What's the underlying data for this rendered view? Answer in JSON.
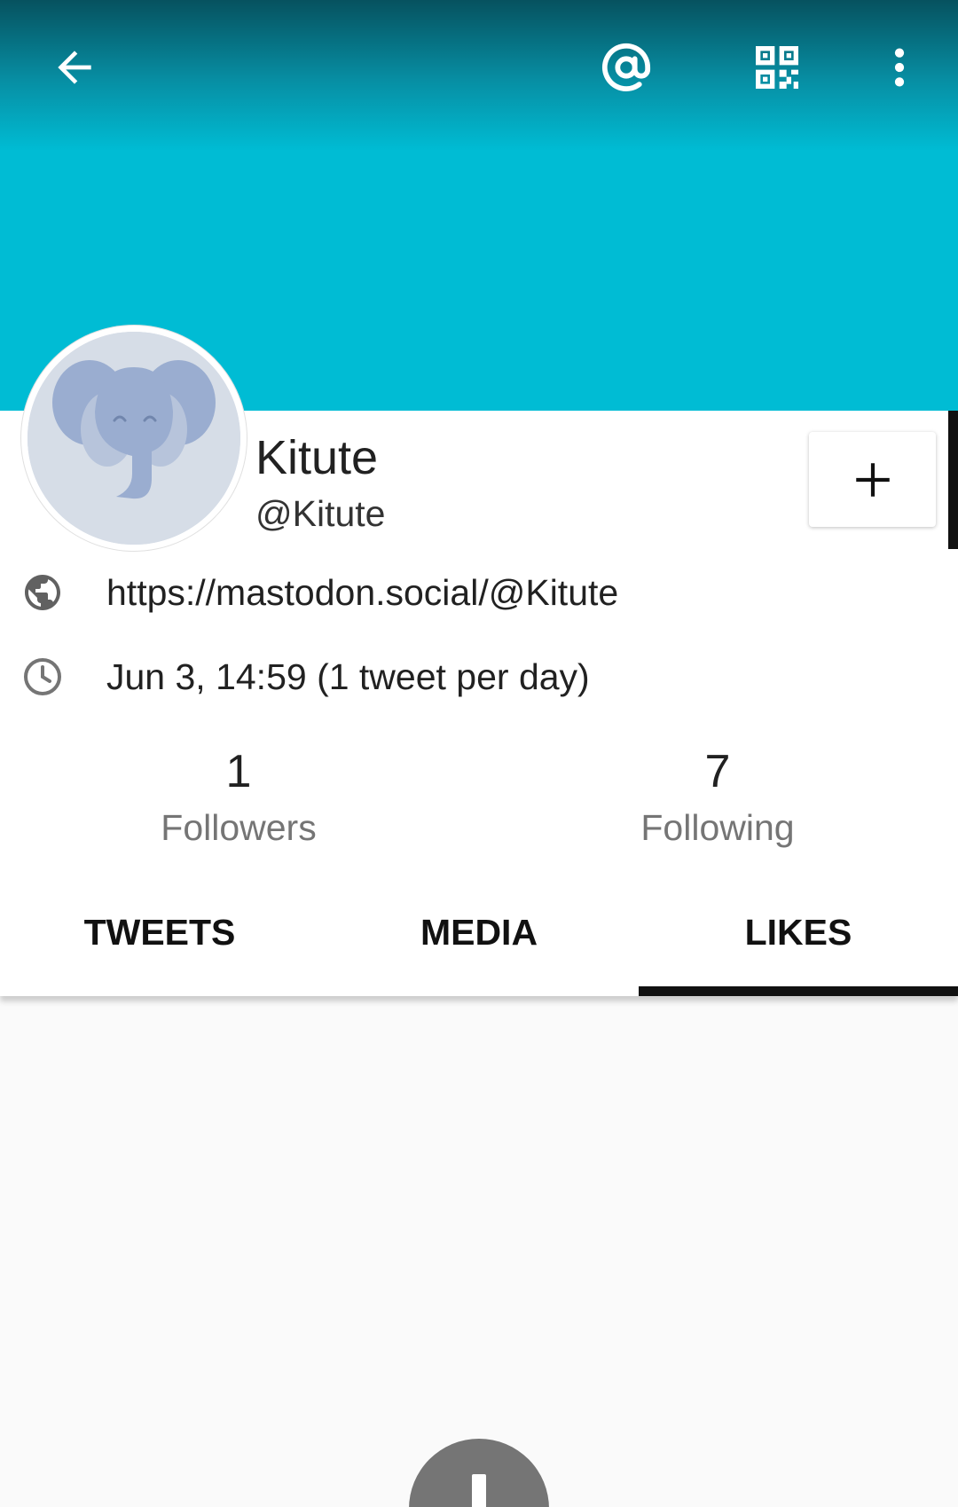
{
  "header": {
    "icons": [
      "arrow-back-icon",
      "at-sign-icon",
      "qr-code-icon",
      "more-vert-icon"
    ],
    "accent_color": "#00bcd4"
  },
  "profile": {
    "display_name": "Kitute",
    "handle": "@Kitute",
    "url": "https://mastodon.social/@Kitute",
    "joined": "Jun 3, 14:59 (1 tweet per day)",
    "avatar": "elephant-avatar-icon"
  },
  "stats": {
    "followers": {
      "count": "1",
      "label": "Followers"
    },
    "following": {
      "count": "7",
      "label": "Following"
    }
  },
  "tabs": [
    {
      "label": "TWEETS",
      "active": false
    },
    {
      "label": "MEDIA",
      "active": false
    },
    {
      "label": "LIKES",
      "active": true
    }
  ]
}
